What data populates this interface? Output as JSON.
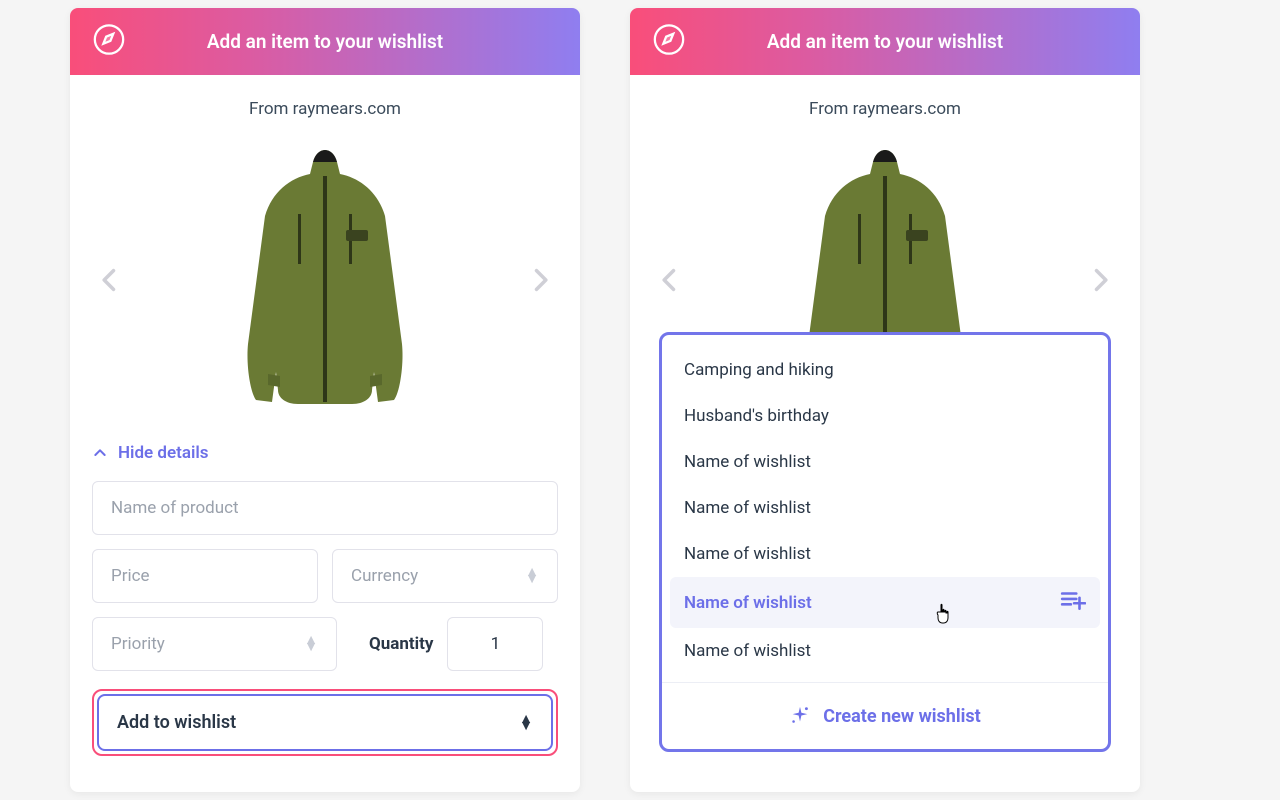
{
  "header_title": "Add an item to your wishlist",
  "from_text": "From raymears.com",
  "hide_details_label": "Hide details",
  "fields": {
    "name_placeholder": "Name of product",
    "price_placeholder": "Price",
    "currency_placeholder": "Currency",
    "priority_placeholder": "Priority",
    "quantity_label": "Quantity",
    "quantity_value": "1"
  },
  "add_to_wishlist_label": "Add to wishlist",
  "dropdown": {
    "items": [
      {
        "label": "Camping and hiking",
        "selected": false
      },
      {
        "label": "Husband's birthday",
        "selected": false
      },
      {
        "label": "Name of wishlist",
        "selected": false
      },
      {
        "label": "Name of wishlist",
        "selected": false
      },
      {
        "label": "Name of wishlist",
        "selected": false
      },
      {
        "label": "Name of wishlist",
        "selected": true
      },
      {
        "label": "Name of wishlist",
        "selected": false
      }
    ],
    "create_label": "Create new wishlist"
  },
  "colors": {
    "accent": "#6c6fe8",
    "pink": "#f94e7a",
    "text": "#2a3747",
    "muted": "#9aa1ac"
  }
}
